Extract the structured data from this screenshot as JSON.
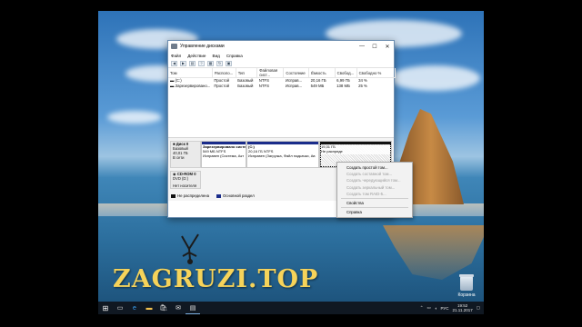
{
  "watermark": "ZAGRUZI.TOP",
  "window": {
    "title": "Управление дисками",
    "minimize": "—",
    "maximize": "☐",
    "close": "✕"
  },
  "menu": [
    "Файл",
    "Действие",
    "Вид",
    "Справка"
  ],
  "toolbar_icons": [
    "back-icon",
    "forward-icon",
    "panes-icon",
    "help-icon",
    "properties-icon",
    "refresh-icon",
    "settings-icon"
  ],
  "volume_table": {
    "columns": [
      "Том",
      "Располо...",
      "Тип",
      "Файловая сист...",
      "Состояние",
      "Ёмкость",
      "Свобод...",
      "Свободно %"
    ],
    "rows": [
      [
        "(C:)",
        "Простой",
        "Базовый",
        "NTFS",
        "Исправ...",
        "20,16 ГБ",
        "6,99 ГБ",
        "34 %"
      ],
      [
        "Зарезервировано...",
        "Простой",
        "Базовый",
        "NTFS",
        "Исправ...",
        "549 МБ",
        "138 МБ",
        "25 %"
      ]
    ]
  },
  "disks": [
    {
      "name": "Диск 0",
      "type": "Базовый",
      "size": "40,01 ГБ",
      "status": "В сети",
      "partitions": [
        {
          "title": "Зарезервировано систе",
          "size": "549 МБ NTFS",
          "status": "Исправен (Система, Акт"
        },
        {
          "title": "(C:)",
          "size": "20,16 ГБ NTFS",
          "status": "Исправен (Загрузка, Файл подкачки, Ав"
        },
        {
          "title": "",
          "size": "19,31 ГБ",
          "status": "Не распреде"
        }
      ]
    },
    {
      "name": "CD-ROM 0",
      "type": "DVD (D:)",
      "size": "",
      "status": "Нет носителя",
      "partitions": []
    }
  ],
  "legend": [
    {
      "label": "Не распределена",
      "color": "#111111"
    },
    {
      "label": "Основной раздел",
      "color": "#1a2c8a"
    }
  ],
  "context_menu": [
    {
      "label": "Создать простой том...",
      "enabled": true
    },
    {
      "label": "Создать составной том...",
      "enabled": false
    },
    {
      "label": "Создать чередующийся том...",
      "enabled": false
    },
    {
      "label": "Создать зеркальный том...",
      "enabled": false
    },
    {
      "label": "Создать том RAID-5...",
      "enabled": false
    },
    {
      "label": "Свойства",
      "enabled": true,
      "separator_before": true
    },
    {
      "label": "Справка",
      "enabled": true,
      "separator_before": true
    }
  ],
  "desktop": {
    "recycle_bin_label": "Корзина"
  },
  "taskbar": {
    "language": "РУС",
    "time": "19:52",
    "date": "21.11.2017"
  }
}
